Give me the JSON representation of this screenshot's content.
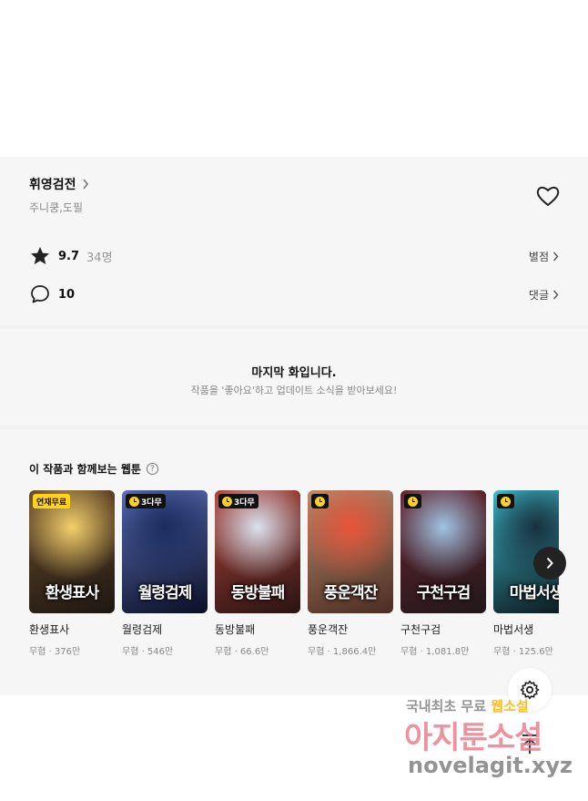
{
  "series": {
    "title": "휘영검전",
    "authors": "주니쿵,도필",
    "rating": "9.7",
    "rating_count": "34명",
    "rating_link": "별점",
    "comment_count": "10",
    "comment_link": "댓글"
  },
  "last_episode": {
    "title": "마지막 화입니다.",
    "subtitle": "작품을 '좋아요'하고 업데이트 소식을 받아보세요!"
  },
  "recommendations": {
    "heading": "이 작품과 함께보는 웹툰",
    "help_symbol": "?",
    "items": [
      {
        "badge": "연재무료",
        "badge_type": "free",
        "cover_text": "환생표사",
        "name": "환생표사",
        "meta": "무협 · 376만",
        "colors": [
          "#f3d06a",
          "#6b4b2a",
          "#1d1712"
        ]
      },
      {
        "badge": "3다무",
        "badge_type": "wait",
        "cover_text": "월령검제",
        "name": "월령검제",
        "meta": "무협 · 546만",
        "colors": [
          "#1b2c5e",
          "#5c6fb8",
          "#0b0f24"
        ]
      },
      {
        "badge": "3다무",
        "badge_type": "wait",
        "cover_text": "동방불패",
        "name": "동방불패",
        "meta": "무협 · 66.6만",
        "colors": [
          "#d9e3ef",
          "#b2443b",
          "#2a1413"
        ]
      },
      {
        "badge": "",
        "badge_type": "wait",
        "cover_text": "풍운객잔",
        "name": "풍운객잔",
        "meta": "무협 · 1,866.4만",
        "colors": [
          "#e8543a",
          "#b98d6c",
          "#4c2c22"
        ]
      },
      {
        "badge": "",
        "badge_type": "wait",
        "cover_text": "구천구검",
        "name": "구천구검",
        "meta": "무협 · 1,081.8만",
        "colors": [
          "#9fc4e3",
          "#6a2430",
          "#21181a"
        ]
      },
      {
        "badge": "",
        "badge_type": "wait",
        "cover_text": "마법서생",
        "name": "마법서생",
        "meta": "무협 · 125.6만",
        "colors": [
          "#18313f",
          "#3dbfd1",
          "#0c1318"
        ]
      }
    ]
  },
  "watermark": {
    "line1_a": "국내최초 무료",
    "line1_b": "웹소설",
    "line2": "아지툰소설",
    "line3": "novelagit.xyz"
  },
  "icons": {
    "title_chevron": "chevron-right-icon",
    "like": "heart-icon",
    "rating": "star-icon",
    "comment": "speech-bubble-icon",
    "next": "chevron-right-icon",
    "settings": "gear-icon",
    "scroll_top": "arrow-up-icon"
  }
}
